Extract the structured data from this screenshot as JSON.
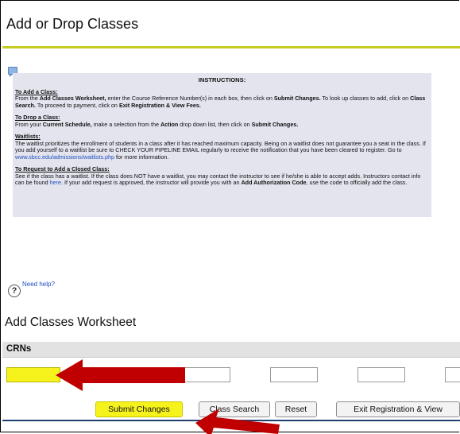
{
  "page": {
    "title": "Add or Drop Classes"
  },
  "instructions": {
    "heading": "INSTRUCTIONS:",
    "add": {
      "title": "To Add a Class:",
      "p1": "From the ",
      "b1": "Add Classes Worksheet,",
      "p2": " enter the Course Reference Number(s) in each box, then click on ",
      "b2": "Submit Changes.",
      "p3": " To look up classes to add, click on ",
      "b3": "Class Search.",
      "p4": " To proceed to payment, click on ",
      "b4": "Exit Registration & View Fees."
    },
    "drop": {
      "title": "To Drop a Class:",
      "p1": "From your ",
      "b1": "Current Schedule,",
      "p2": " make a selection from the ",
      "b2": "Action",
      "p3": " drop down list, then click on ",
      "b3": "Submit Changes."
    },
    "waitlists": {
      "title": "Waitlists:",
      "p1": "The waitlist prioritizes the enrollment of students in a class after it has reached maximum capacity. Being on a waitlist does not guarantee you a seat in the class. If you add yourself to a waitlist be sure to CHECK YOUR PIPELINE EMAIL regularly to receive the notification that you have been cleared to register. Go to ",
      "link": "www.sbcc.edu/admissions/waitlists.php",
      "p2": " for more information."
    },
    "closed": {
      "title": "To Request to Add a Closed Class:",
      "p1": "See if the class has a waitlist. If the class does NOT have a waitlist, you may contact the instructor to see if he/she is able to accept adds. Instructors contact info can be found ",
      "link": "here",
      "p2": ". If your add request is approved, the instructor will provide you with an ",
      "b1": "Add Authorization Code",
      "p3": ", use the code to officially add the class."
    }
  },
  "help": {
    "icon": "?",
    "link_text": "Need help?"
  },
  "worksheet": {
    "title": "Add Classes Worksheet",
    "crn_header": "CRNs",
    "crn_values": [
      "",
      "",
      "",
      "",
      "",
      ""
    ]
  },
  "buttons": {
    "submit": "Submit Changes",
    "class_search": "Class Search",
    "reset": "Reset",
    "exit": "Exit Registration & View"
  },
  "colors": {
    "highlight": "#f6f31c",
    "arrow": "#c00000",
    "title_rule": "#c6cc22",
    "instructions_bg": "#e3e4ee"
  }
}
